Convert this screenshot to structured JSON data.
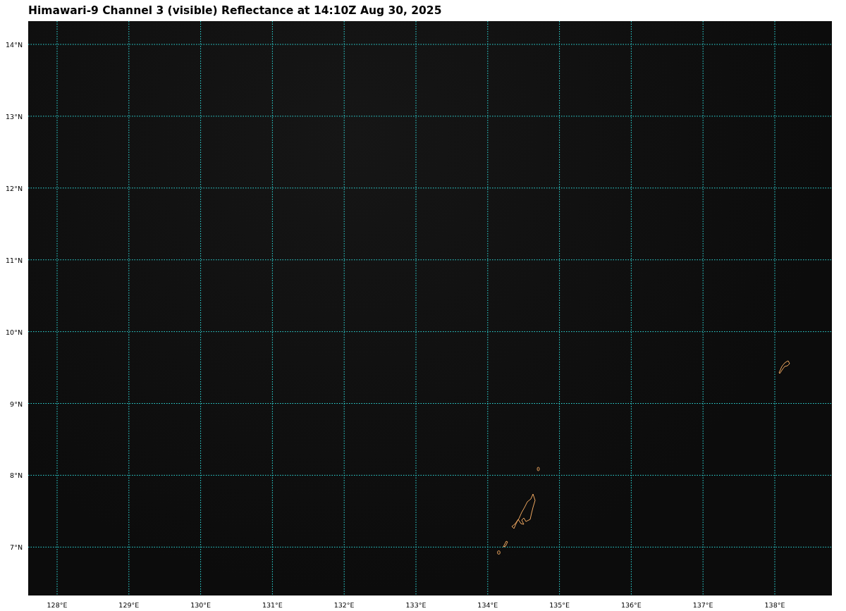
{
  "title": "Himawari-9 Channel 3 (visible) Reflectance at 14:10Z Aug 30, 2025",
  "lat_labels": [
    "14°N",
    "13°N",
    "12°N",
    "11°N",
    "10°N",
    "9°N",
    "8°N",
    "7°N"
  ],
  "lon_labels": [
    "128°E",
    "129°E",
    "130°E",
    "131°E",
    "132°E",
    "133°E",
    "134°E",
    "135°E",
    "136°E",
    "137°E",
    "138°E"
  ]
}
